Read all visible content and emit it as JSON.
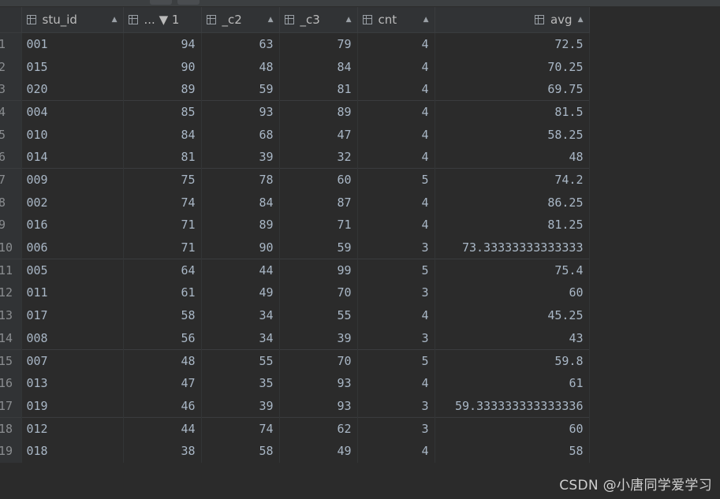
{
  "columns": {
    "stu_id": "stu_id",
    "c1": "... ▼ 1",
    "c2": "_c2",
    "c3": "_c3",
    "cnt": "cnt",
    "avg": "avg"
  },
  "rows": [
    {
      "n": "1",
      "stu_id": "001",
      "c1": "94",
      "c2": "63",
      "c3": "79",
      "cnt": "4",
      "avg": "72.5"
    },
    {
      "n": "2",
      "stu_id": "015",
      "c1": "90",
      "c2": "48",
      "c3": "84",
      "cnt": "4",
      "avg": "70.25"
    },
    {
      "n": "3",
      "stu_id": "020",
      "c1": "89",
      "c2": "59",
      "c3": "81",
      "cnt": "4",
      "avg": "69.75"
    },
    {
      "n": "4",
      "stu_id": "004",
      "c1": "85",
      "c2": "93",
      "c3": "89",
      "cnt": "4",
      "avg": "81.5"
    },
    {
      "n": "5",
      "stu_id": "010",
      "c1": "84",
      "c2": "68",
      "c3": "47",
      "cnt": "4",
      "avg": "58.25"
    },
    {
      "n": "6",
      "stu_id": "014",
      "c1": "81",
      "c2": "39",
      "c3": "32",
      "cnt": "4",
      "avg": "48"
    },
    {
      "n": "7",
      "stu_id": "009",
      "c1": "75",
      "c2": "78",
      "c3": "60",
      "cnt": "5",
      "avg": "74.2"
    },
    {
      "n": "8",
      "stu_id": "002",
      "c1": "74",
      "c2": "84",
      "c3": "87",
      "cnt": "4",
      "avg": "86.25"
    },
    {
      "n": "9",
      "stu_id": "016",
      "c1": "71",
      "c2": "89",
      "c3": "71",
      "cnt": "4",
      "avg": "81.25"
    },
    {
      "n": "10",
      "stu_id": "006",
      "c1": "71",
      "c2": "90",
      "c3": "59",
      "cnt": "3",
      "avg": "73.33333333333333"
    },
    {
      "n": "11",
      "stu_id": "005",
      "c1": "64",
      "c2": "44",
      "c3": "99",
      "cnt": "5",
      "avg": "75.4"
    },
    {
      "n": "12",
      "stu_id": "011",
      "c1": "61",
      "c2": "49",
      "c3": "70",
      "cnt": "3",
      "avg": "60"
    },
    {
      "n": "13",
      "stu_id": "017",
      "c1": "58",
      "c2": "34",
      "c3": "55",
      "cnt": "4",
      "avg": "45.25"
    },
    {
      "n": "14",
      "stu_id": "008",
      "c1": "56",
      "c2": "34",
      "c3": "39",
      "cnt": "3",
      "avg": "43"
    },
    {
      "n": "15",
      "stu_id": "007",
      "c1": "48",
      "c2": "55",
      "c3": "70",
      "cnt": "5",
      "avg": "59.8"
    },
    {
      "n": "16",
      "stu_id": "013",
      "c1": "47",
      "c2": "35",
      "c3": "93",
      "cnt": "4",
      "avg": "61"
    },
    {
      "n": "17",
      "stu_id": "019",
      "c1": "46",
      "c2": "39",
      "c3": "93",
      "cnt": "3",
      "avg": "59.333333333333336"
    },
    {
      "n": "18",
      "stu_id": "012",
      "c1": "44",
      "c2": "74",
      "c3": "62",
      "cnt": "3",
      "avg": "60"
    },
    {
      "n": "19",
      "stu_id": "018",
      "c1": "38",
      "c2": "58",
      "c3": "49",
      "cnt": "4",
      "avg": "58"
    }
  ],
  "watermark": "CSDN @小唐同学爱学习"
}
